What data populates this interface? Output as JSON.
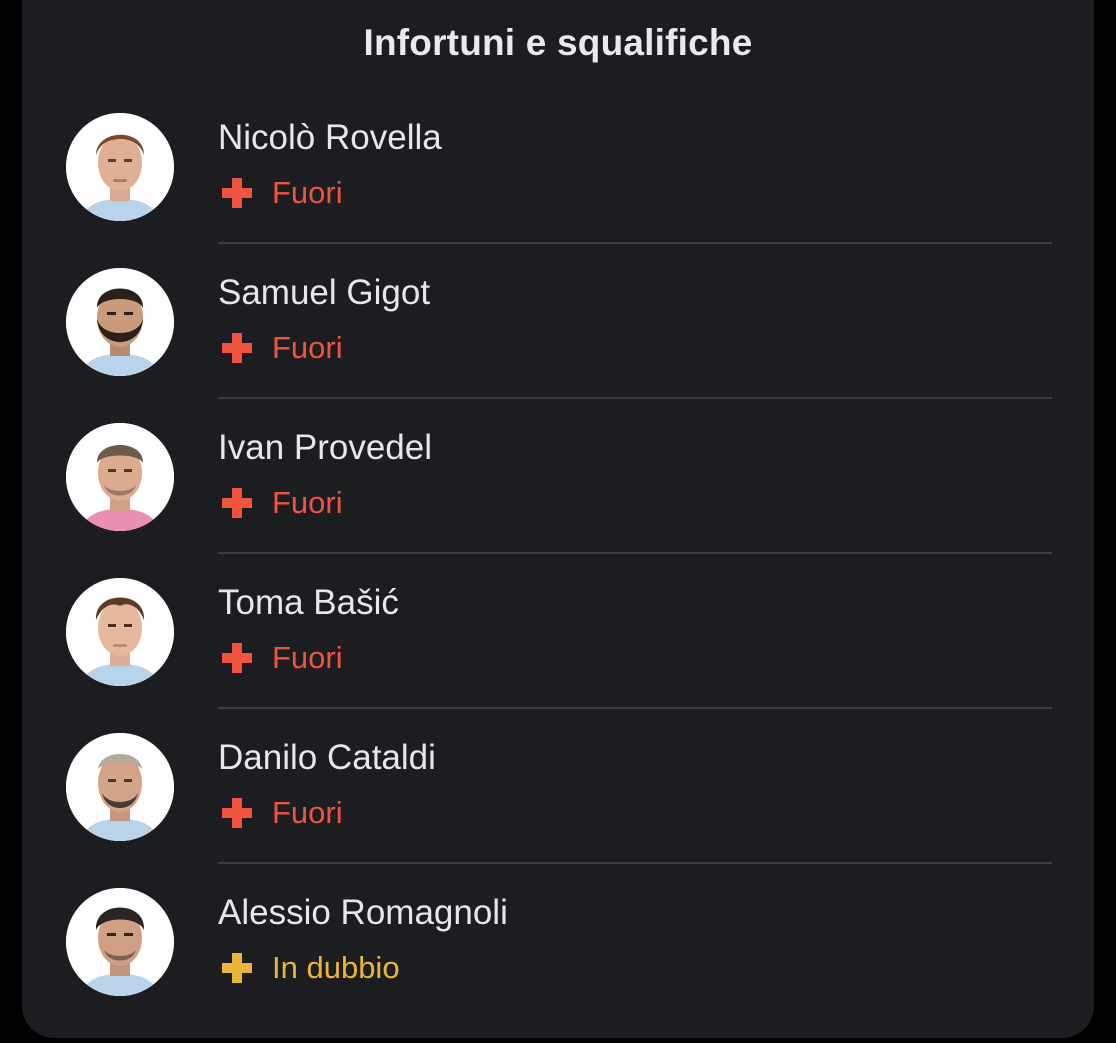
{
  "title": "Infortuni e squalifiche",
  "colors": {
    "out": "#f0533e",
    "doubtful": "#e9b53a"
  },
  "players": [
    {
      "name": "Nicolò Rovella",
      "status": "Fuori",
      "status_type": "out",
      "icon": "medical-cross-icon"
    },
    {
      "name": "Samuel Gigot",
      "status": "Fuori",
      "status_type": "out",
      "icon": "medical-cross-icon"
    },
    {
      "name": "Ivan Provedel",
      "status": "Fuori",
      "status_type": "out",
      "icon": "medical-cross-icon"
    },
    {
      "name": "Toma Bašić",
      "status": "Fuori",
      "status_type": "out",
      "icon": "medical-cross-icon"
    },
    {
      "name": "Danilo Cataldi",
      "status": "Fuori",
      "status_type": "out",
      "icon": "medical-cross-icon"
    },
    {
      "name": "Alessio Romagnoli",
      "status": "In dubbio",
      "status_type": "doubtful",
      "icon": "medical-cross-icon"
    }
  ]
}
